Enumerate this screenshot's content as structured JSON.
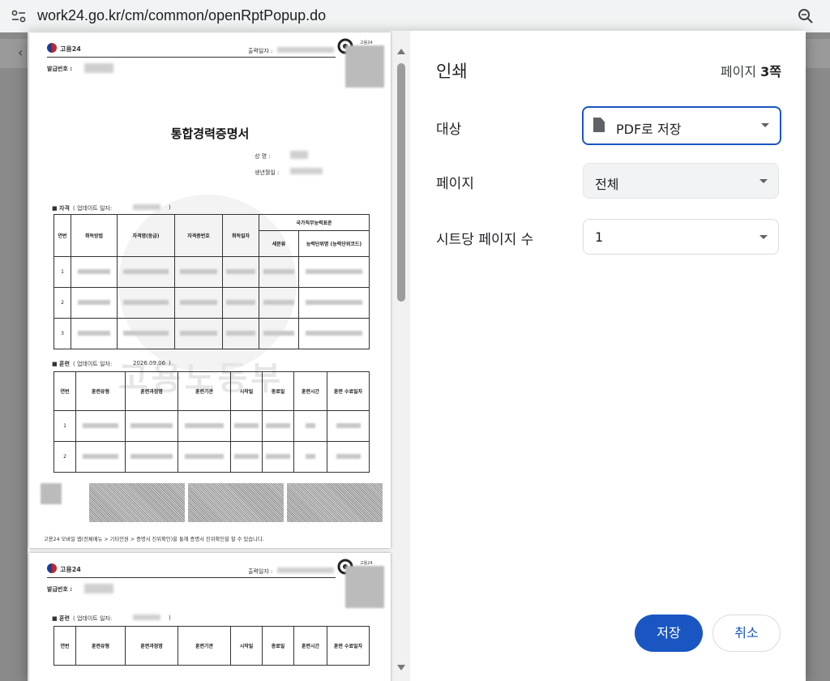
{
  "browser": {
    "url": "work24.go.kr/cm/common/openRptPopup.do",
    "site_icon": "tune-icon",
    "zoom_icon": "zoom-icon"
  },
  "print": {
    "title": "인쇄",
    "pages_prefix": "페이지 ",
    "pages_value": "3쪽",
    "destination_label": "대상",
    "destination_value": "PDF로 저장",
    "pages_label": "페이지",
    "pages_option": "전체",
    "pps_label": "시트당 페이지 수",
    "pps_value": "1",
    "save_label": "저장",
    "cancel_label": "취소"
  },
  "doc": {
    "logo_text": "고용24",
    "print_date_label": "출력일자 :",
    "issue_no_label": "발급번호 :",
    "doc_title": "통합경력증명서",
    "name_label": "성    명 :",
    "birth_label": "생년월일 :",
    "qual_section": "■ 자격",
    "update_label": "( 업데이트 일자:",
    "close_paren": ")",
    "training_section": "■ 훈련",
    "training_update_date": "2026.09.06",
    "qual_headers": [
      "연번",
      "취득방법",
      "자격명(등급)",
      "자격증번호",
      "취득일자",
      "국가직무능력표준",
      "세분류",
      "능력단위명 (능력단위코드)"
    ],
    "training_headers": [
      "연번",
      "훈련유형",
      "훈련과정명",
      "훈련기관",
      "시작일",
      "종료일",
      "훈련시간",
      "훈련 수료일자"
    ],
    "row_numbers": [
      "1",
      "2",
      "3"
    ],
    "footer_note": "고용24 모바일 앱(전체메뉴 > 기타민원 > 증명서 진위확인)을 통해 증명서 진위확인을 할 수 있습니다.",
    "side_stamp": "고용24",
    "watermark": "고용노동부"
  }
}
